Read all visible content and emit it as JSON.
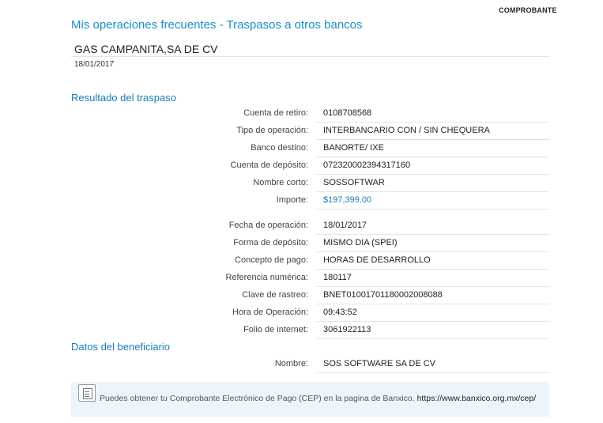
{
  "header": {
    "receipt_label": "COMPROBANTE",
    "title": "Mis operaciones frecuentes - Traspasos a otros bancos"
  },
  "company": {
    "name": "GAS CAMPANITA,SA DE CV",
    "date": "18/01/2017"
  },
  "result": {
    "title": "Resultado del traspaso",
    "group1": [
      {
        "label": "Cuenta de retiro:",
        "value": "0108708568"
      },
      {
        "label": "Tipo de operación:",
        "value": "INTERBANCARIO CON / SIN CHEQUERA"
      },
      {
        "label": "Banco destino:",
        "value": "BANORTE/ IXE"
      },
      {
        "label": "Cuenta de depósito:",
        "value": "072320002394317160"
      },
      {
        "label": "Nombre corto:",
        "value": "SOSSOFTWAR"
      },
      {
        "label": "Importe:",
        "value": "$197,399.00"
      }
    ],
    "group2": [
      {
        "label": "Fecha de operación:",
        "value": "18/01/2017"
      },
      {
        "label": "Forma de depósito:",
        "value": "MISMO DIA (SPEI)"
      },
      {
        "label": "Concepto de pago:",
        "value": "HORAS DE DESARROLLO"
      },
      {
        "label": "Referencia numérica:",
        "value": "180117"
      },
      {
        "label": "Clave de rastreo:",
        "value": "BNET01001701180002008088"
      },
      {
        "label": "Hora de Operación:",
        "value": "09:43:52"
      },
      {
        "label": "Folio de internet:",
        "value": "3061922113"
      }
    ]
  },
  "beneficiary": {
    "title": "Datos del beneficiario",
    "rows": [
      {
        "label": "Nombre:",
        "value": "SOS SOFTWARE SA DE CV"
      }
    ]
  },
  "notice": {
    "icon": "document-icon",
    "text": "Puedes obtener tu Comprobante Electrónico de Pago (CEP) en la pagina de Banxico.",
    "url": "https://www.banxico.org.mx/cep/"
  },
  "colors": {
    "title_blue": "#1a8fc9",
    "section_blue": "#1a7cb8",
    "notice_bg": "#eef5fa"
  }
}
